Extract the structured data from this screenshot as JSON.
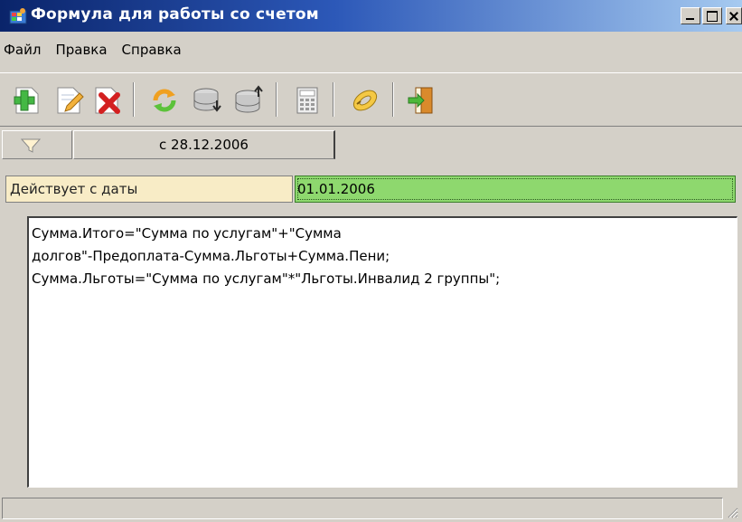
{
  "window": {
    "title": "Формула для работы со счетом"
  },
  "menu": {
    "items": [
      "Файл",
      "Правка",
      "Справка"
    ]
  },
  "toolbar": {
    "buttons": [
      {
        "icon": "add-icon"
      },
      {
        "icon": "edit-icon"
      },
      {
        "icon": "delete-icon"
      },
      {
        "icon": "refresh-icon"
      },
      {
        "icon": "db-down-icon"
      },
      {
        "icon": "db-up-icon"
      },
      {
        "icon": "calculator-icon"
      },
      {
        "icon": "link-icon"
      },
      {
        "icon": "exit-icon"
      }
    ]
  },
  "filter": {
    "date_tab_label": "с 28.12.2006",
    "icon": "filter-icon"
  },
  "effective": {
    "label": "Действует с даты",
    "value": "01.01.2006"
  },
  "formula": {
    "lines": [
      "Сумма.Итого=\"Сумма по услугам\"+\"Сумма",
      "долгов\"-Предоплата-Сумма.Льготы+Сумма.Пени;",
      "Сумма.Льготы=\"Сумма по услугам\"*\"Льготы.Инвалид 2 группы\";"
    ]
  },
  "colors": {
    "titlebar_start": "#0a246a",
    "titlebar_end": "#a6caf0",
    "window_bg": "#d4d0c8",
    "label_bg": "#f8ecc6",
    "value_bg": "#8ed86e"
  }
}
